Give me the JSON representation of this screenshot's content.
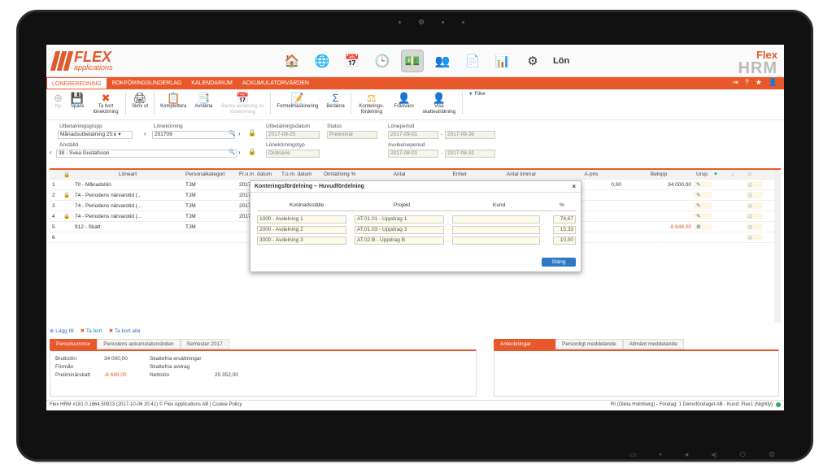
{
  "logo": {
    "line1": "FLEX",
    "line2": "applications"
  },
  "brand": {
    "line1": "Flex",
    "line2": "HRM"
  },
  "app_title": "Lön",
  "nav": {
    "tabs": [
      "LÖNEBEREDNING",
      "BOKFÖRINGSUNDERLAG",
      "KALENDARIUM",
      "ACKUMULATORVÄRDEN"
    ],
    "icons": [
      "exit-icon",
      "help-icon",
      "star-icon",
      "user-icon"
    ]
  },
  "toolbar": [
    {
      "label": "Ny",
      "icon": "new-icon",
      "disabled": true
    },
    {
      "label": "Spara",
      "icon": "save-icon",
      "disabled": false
    },
    {
      "label": "Ta bort lönekörning",
      "icon": "delete-icon",
      "disabled": false
    },
    {
      "label": "Skriv ut",
      "icon": "print-icon",
      "disabled": false
    },
    {
      "label": "Komplettera",
      "icon": "complete-icon",
      "disabled": false
    },
    {
      "label": "Avräkna",
      "icon": "settle-icon",
      "disabled": false
    },
    {
      "label": "Backa avräkning av lönekörning",
      "icon": "undo-icon",
      "disabled": true
    },
    {
      "label": "Formelmaskinering",
      "icon": "formula-icon",
      "disabled": false
    },
    {
      "label": "Beräkna",
      "icon": "sum-icon",
      "disabled": false
    },
    {
      "label": "Konterings-fördelning",
      "icon": "scale-icon",
      "disabled": false
    },
    {
      "label": "Frånvaro",
      "icon": "absence-icon",
      "disabled": false
    },
    {
      "label": "Visa skatteuträkning",
      "icon": "tax-icon",
      "disabled": false
    },
    {
      "label": "Filter",
      "icon": "filter-icon",
      "disabled": false
    }
  ],
  "form": {
    "utbetalningsgrupp_label": "Utbetalningsgrupp",
    "utbetalningsgrupp_value": "Månadsutbetalning 25:e ▾",
    "lonekorning_label": "Lönekörning",
    "lonekorning_value": "201709",
    "utbetalningsdatum_label": "Utbetalningsdatum",
    "utbetalningsdatum_value": "2017-09-25",
    "status_label": "Status",
    "status_value": "Preliminär",
    "loneperiod_label": "Löneperiod",
    "loneperiod_from": "2017-09-01",
    "loneperiod_to": "2017-09-30",
    "anstalld_label": "Anställd",
    "anstalld_value": "38 - Svea Gustafsson",
    "lonekorningstyp_label": "Lönekörningstyp",
    "lonekorningstyp_value": "Ordinarie",
    "avvikelseperiod_label": "Avvikelseperiod",
    "avvikelseperiod_from": "2017-08-01",
    "avvikelseperiod_to": "2017-08-31"
  },
  "grid": {
    "columns": [
      "",
      "",
      "Löneart",
      "Personalkategori",
      "Fr.o.m. datum",
      "T.o.m. datum",
      "Omfattning %",
      "Antal",
      "Enhet",
      "Antal timmar",
      "A-pris",
      "Belopp",
      "Ursp.",
      "",
      "",
      ""
    ],
    "rows": [
      {
        "n": "1",
        "lock": false,
        "art": "70 - Månadslön",
        "kat": "TJM",
        "from": "2017-09-",
        "apris": "0,00",
        "belopp": "34 000,00",
        "neg": false
      },
      {
        "n": "2",
        "lock": true,
        "art": "74 - Periodens närvarotid (...",
        "kat": "TJM",
        "from": "2017-08-",
        "apris": "",
        "belopp": "",
        "neg": false
      },
      {
        "n": "3",
        "lock": false,
        "art": "74 - Periodens närvarotid (...",
        "kat": "TJM",
        "from": "2017-08-",
        "apris": "",
        "belopp": "",
        "neg": false
      },
      {
        "n": "4",
        "lock": true,
        "art": "74 - Periodens närvarotid (...",
        "kat": "TJM",
        "from": "2017-08-",
        "apris": "",
        "belopp": "",
        "neg": false
      },
      {
        "n": "5",
        "lock": false,
        "art": "912 - Skatt",
        "kat": "TJM",
        "from": "",
        "apris": "",
        "belopp": "-8 648,00",
        "neg": true
      },
      {
        "n": "6",
        "lock": false,
        "art": "",
        "kat": "",
        "from": "",
        "apris": "",
        "belopp": "",
        "neg": false
      }
    ]
  },
  "rowtools": {
    "add": "Lägg till",
    "remove": "Ta bort",
    "remove_all": "Ta bort alla"
  },
  "left_tabs": [
    "Periodsummor",
    "Periodens ackumulatorvärden",
    "Semester 2017"
  ],
  "summary": {
    "bruttolon_label": "Bruttolön",
    "bruttolon_value": "34 000,00",
    "forman_label": "Förmån",
    "prelskatt_label": "Preliminärskatt",
    "prelskatt_value": "-8 648,00",
    "skattefria_ers_label": "Skattefria ersättningar",
    "skattefria_avdrag_label": "Skattefria avdrag",
    "nettolon_label": "Nettolön",
    "nettolon_value": "25 352,00"
  },
  "right_tabs": [
    "Anteckningar",
    "Personligt meddelande",
    "Allmänt meddelande"
  ],
  "status": {
    "left": "Flex HRM #181.0.1664.50923 (2017-10-06 20:41) © Flex Applications AB | Cookie Policy",
    "right": "RI (Olivia Holmberg) - Företag: 1 Demoföretaget AB - Kund: Flex1 (Nightly)"
  },
  "dialog": {
    "title": "Konteringsfördelning – Huvudfördelning",
    "close": "×",
    "columns": [
      "Kostnadsställe",
      "Projekt",
      "Kund",
      "%"
    ],
    "rows": [
      {
        "kst": "1000 - Avdelning 1",
        "proj": "AT.01.01 - Uppdrag 1",
        "kund": "",
        "pct": "74,67"
      },
      {
        "kst": "2000 - Avdelning 2",
        "proj": "AT.01.03 - Uppdrag 3",
        "kund": "",
        "pct": "15,33"
      },
      {
        "kst": "3000 - Avdelning 3",
        "proj": "AT.02.B - Uppdrag B",
        "kund": "",
        "pct": "10,00"
      }
    ],
    "button": "Stäng"
  },
  "colors": {
    "accent": "#e8582a",
    "primary_button": "#2f78c4",
    "lock": "#e7a520"
  }
}
